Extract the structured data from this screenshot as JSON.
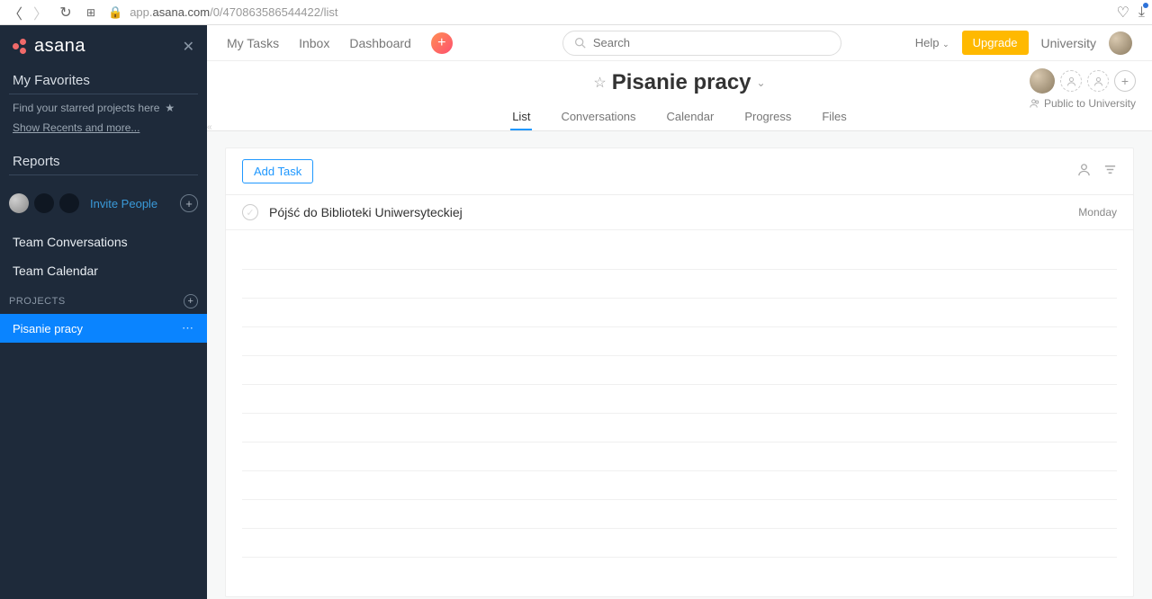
{
  "browser": {
    "url_prefix": "app.",
    "url_domain": "asana.com",
    "url_path": "/0/470863586544422/list"
  },
  "sidebar": {
    "logo_text": "asana",
    "favorites_title": "My Favorites",
    "find_starred": "Find your starred projects here",
    "show_recents": "Show Recents and more...",
    "reports_title": "Reports",
    "invite_label": "Invite People",
    "team_conversations": "Team Conversations",
    "team_calendar": "Team Calendar",
    "projects_heading": "PROJECTS",
    "project_name": "Pisanie pracy"
  },
  "topbar": {
    "my_tasks": "My Tasks",
    "inbox": "Inbox",
    "dashboard": "Dashboard",
    "search_placeholder": "Search",
    "help": "Help",
    "upgrade": "Upgrade",
    "workspace": "University"
  },
  "project_header": {
    "title": "Pisanie pracy",
    "tabs": {
      "list": "List",
      "conversations": "Conversations",
      "calendar": "Calendar",
      "progress": "Progress",
      "files": "Files"
    },
    "public_label": "Public to University"
  },
  "tasks": {
    "add_label": "Add Task",
    "rows": [
      {
        "name": "Pójść do Biblioteki Uniwersyteckiej",
        "date": "Monday"
      }
    ]
  }
}
